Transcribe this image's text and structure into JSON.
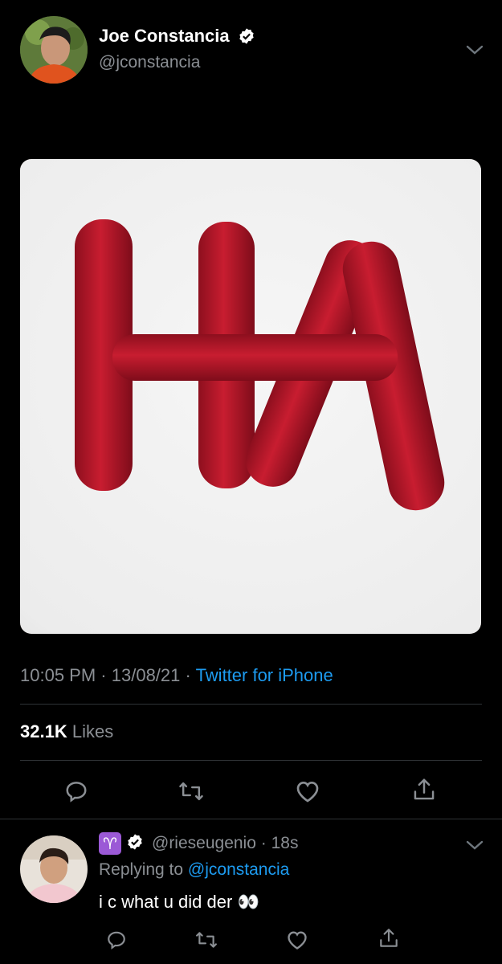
{
  "tweet": {
    "author_name": "Joe Constancia",
    "author_handle": "@jconstancia",
    "time": "10:05 PM",
    "date": "13/08/21",
    "source": "Twitter for iPhone",
    "sep": "·",
    "likes_count": "32.1K",
    "likes_label": "Likes"
  },
  "reply": {
    "handle": "@rieseugenio",
    "time": "18s",
    "sep": "·",
    "replying_label": "Replying to",
    "replying_handle": "@jconstancia",
    "text": "i c what u did der",
    "emoji": "👀",
    "zodiac": "♈"
  },
  "colors": {
    "link": "#1d9bf0",
    "verified": "#ffffff",
    "zodiac_bg": "#9b59d6",
    "sausage": "#b8182a"
  },
  "icons": {
    "reply": "reply-icon",
    "retweet": "retweet-icon",
    "like": "heart-icon",
    "share": "share-icon",
    "more": "chevron-down-icon"
  }
}
